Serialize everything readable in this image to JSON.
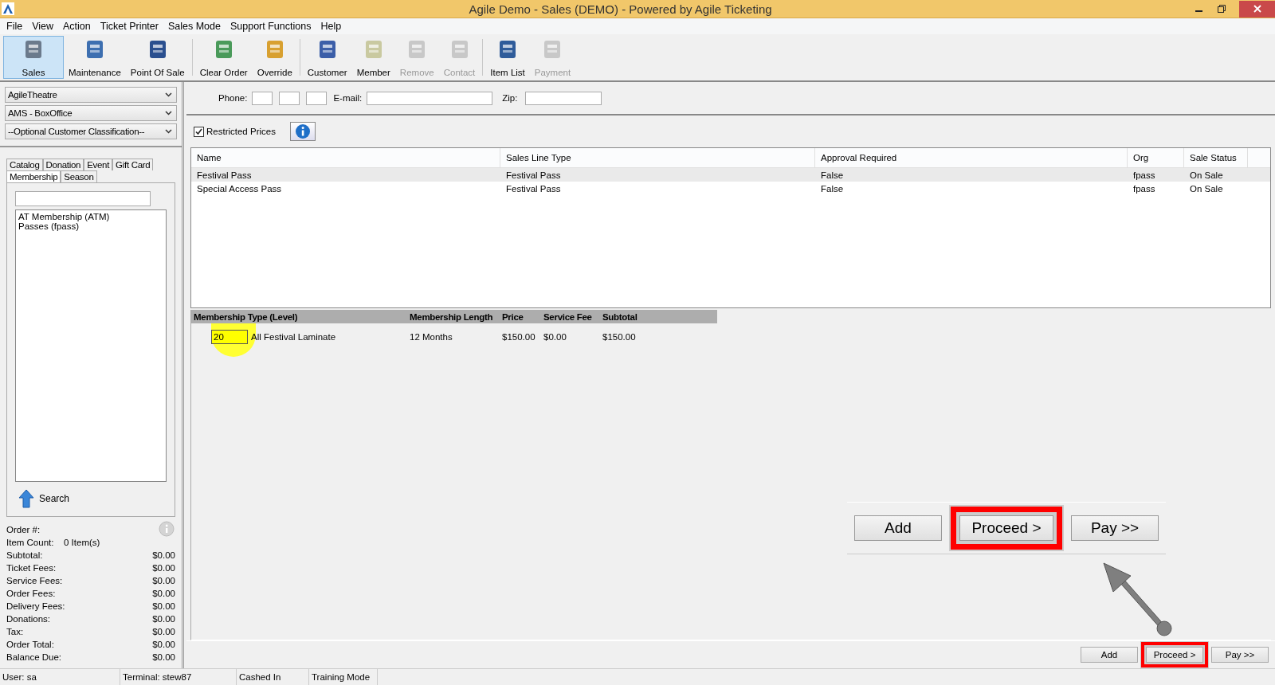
{
  "window": {
    "title": "Agile Demo - Sales (DEMO) - Powered by Agile Ticketing"
  },
  "menu": [
    "File",
    "View",
    "Action",
    "Ticket Printer",
    "Sales Mode",
    "Support Functions",
    "Help"
  ],
  "toolbar": [
    [
      {
        "label": "Sales",
        "selected": true,
        "disabled": false
      },
      {
        "label": "Maintenance",
        "selected": false,
        "disabled": false
      },
      {
        "label": "Point Of Sale",
        "selected": false,
        "disabled": false
      }
    ],
    [
      {
        "label": "Clear Order",
        "selected": false,
        "disabled": false
      },
      {
        "label": "Override",
        "selected": false,
        "disabled": false
      }
    ],
    [
      {
        "label": "Customer",
        "selected": false,
        "disabled": false
      },
      {
        "label": "Member",
        "selected": false,
        "disabled": false
      },
      {
        "label": "Remove",
        "selected": false,
        "disabled": true
      },
      {
        "label": "Contact",
        "selected": false,
        "disabled": true
      }
    ],
    [
      {
        "label": "Item List",
        "selected": false,
        "disabled": false
      },
      {
        "label": "Payment",
        "selected": false,
        "disabled": true
      }
    ]
  ],
  "dropdowns": [
    "AgileTheatre",
    "AMS - BoxOffice",
    "--Optional Customer Classification--"
  ],
  "left_tabs": [
    [
      {
        "label": "Catalog",
        "selected": false
      },
      {
        "label": "Donation",
        "selected": false
      },
      {
        "label": "Event",
        "selected": false
      },
      {
        "label": "Gift Card",
        "selected": false
      }
    ],
    [
      {
        "label": "Membership",
        "selected": true
      },
      {
        "label": "Season",
        "selected": false
      }
    ]
  ],
  "list_items": [
    "AT Membership  (ATM)",
    "Passes  (fpass)"
  ],
  "search_button": "Search",
  "order_summary": {
    "order_number": "Order #:",
    "item_count_label": "Item Count:",
    "item_count": "0 Item(s)",
    "rows": [
      {
        "label": "Subtotal:",
        "value": "$0.00"
      },
      {
        "label": "Ticket Fees:",
        "value": "$0.00"
      },
      {
        "label": "Service Fees:",
        "value": "$0.00"
      },
      {
        "label": "Order Fees:",
        "value": "$0.00"
      },
      {
        "label": "Delivery Fees:",
        "value": "$0.00"
      },
      {
        "label": "Donations:",
        "value": "$0.00"
      },
      {
        "label": "Tax:",
        "value": "$0.00"
      },
      {
        "label": "Order Total:",
        "value": "$0.00"
      },
      {
        "label": "Balance Due:",
        "value": "$0.00"
      }
    ]
  },
  "customer_fields": {
    "phone_label": "Phone:",
    "email_label": "E-mail:",
    "zip_label": "Zip:"
  },
  "restricted_prices": {
    "label": "Restricted Prices",
    "checked": true
  },
  "table": {
    "columns": [
      "Name",
      "Sales Line Type",
      "Approval Required",
      "Org",
      "Sale Status"
    ],
    "rows": [
      {
        "cells": [
          "Festival Pass",
          "Festival Pass",
          "False",
          "fpass",
          "On Sale"
        ],
        "selected": true
      },
      {
        "cells": [
          "Special Access Pass",
          "Festival Pass",
          "False",
          "fpass",
          "On Sale"
        ],
        "selected": false
      }
    ]
  },
  "membership": {
    "columns": [
      "Membership Type (Level)",
      "Membership Length",
      "Price",
      "Service Fee",
      "Subtotal"
    ],
    "rows": [
      {
        "quantity": "20",
        "type": "All Festival Laminate",
        "length": "12 Months",
        "price": "$150.00",
        "service_fee": "$0.00",
        "subtotal": "$150.00"
      }
    ]
  },
  "callout_buttons": [
    {
      "label": "Add",
      "highlighted": false
    },
    {
      "label": "Proceed >",
      "highlighted": true
    },
    {
      "label": "Pay >>",
      "highlighted": false
    }
  ],
  "action_buttons": [
    {
      "label": "Add",
      "highlighted": false
    },
    {
      "label": "Proceed >",
      "highlighted": true
    },
    {
      "label": "Pay >>",
      "highlighted": false
    }
  ],
  "status_bar": [
    "User:  sa",
    "Terminal: stew87",
    "Cashed In",
    "Training Mode"
  ]
}
